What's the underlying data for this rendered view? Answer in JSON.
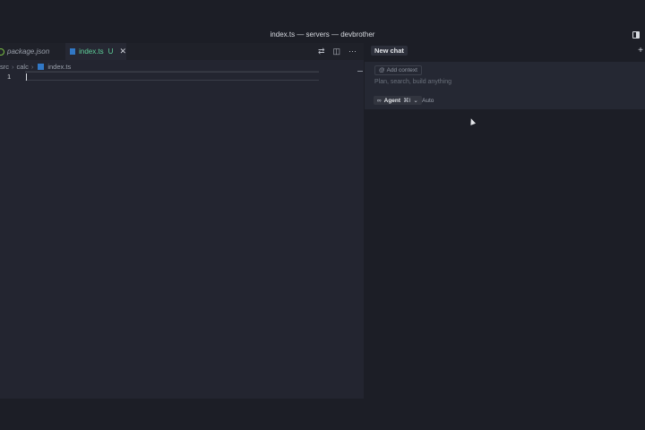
{
  "window": {
    "title": "index.ts — servers — devbrother"
  },
  "tabs": [
    {
      "label": "package.json"
    },
    {
      "label": "index.ts",
      "modified": "U"
    }
  ],
  "breadcrumb": [
    "src",
    "calc",
    "index.ts"
  ],
  "editor": {
    "line_number": "1"
  },
  "chat": {
    "new_chat_label": "New chat",
    "add_context_label": "Add context",
    "placeholder": "Plan, search, build anything",
    "mode_label": "Agent",
    "mode_shortcut": "⌘I",
    "model_label": "Auto"
  }
}
